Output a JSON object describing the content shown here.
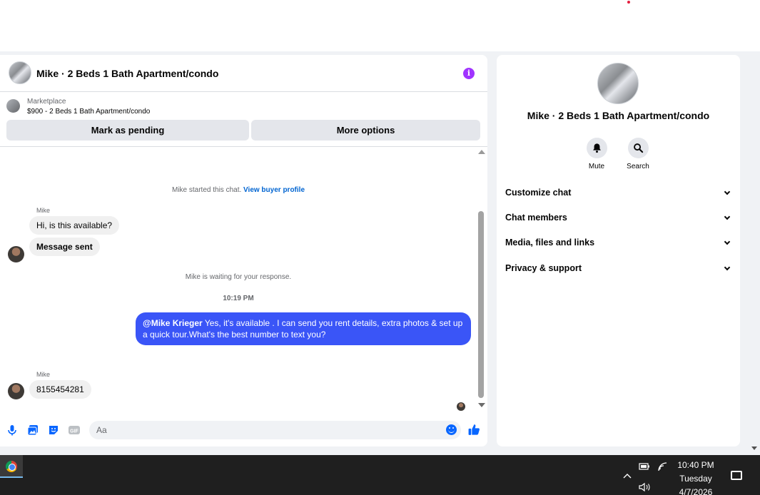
{
  "chat": {
    "title": "Mike · 2 Beds 1 Bath Apartment/condo",
    "listing": {
      "source": "Marketplace",
      "price_title": "$900 - 2 Beds 1 Bath Apartment/condo"
    },
    "buttons": {
      "pending": "Mark as pending",
      "more": "More options"
    },
    "messages": {
      "started_text": "Mike started this chat.",
      "view_profile": "View buyer profile",
      "sender1": "Mike",
      "incoming1": "Hi, is this available?",
      "incoming2": "Message sent",
      "waiting": "Mike is waiting for your response.",
      "time": "10:19 PM",
      "outgoing_mention": "@Mike Krieger",
      "outgoing_text": " Yes, it's available .  I can send you rent details, extra photos & set up a quick tour.What's the best number to text you?",
      "sender2": "Mike",
      "incoming3": "8155454281"
    },
    "composer": {
      "placeholder": "Aa",
      "icons": [
        "microphone-icon",
        "photo-icon",
        "sticker-icon",
        "gif-icon",
        "emoji-icon",
        "like-icon"
      ],
      "gif_label": "GIF"
    }
  },
  "info_panel": {
    "name": "Mike · 2 Beds 1 Bath Apartment/condo",
    "actions": [
      {
        "label": "Mute",
        "icon": "bell-icon"
      },
      {
        "label": "Search",
        "icon": "search-icon"
      }
    ],
    "sections": [
      "Customize chat",
      "Chat members",
      "Media, files and links",
      "Privacy & support"
    ]
  },
  "taskbar": {
    "time": "10:40 PM",
    "day": "Tuesday",
    "date": "4/7/2026"
  },
  "colors": {
    "accent": "#0866ff",
    "outgoing_bubble": "#3a55f7",
    "info": "#a033ff"
  }
}
